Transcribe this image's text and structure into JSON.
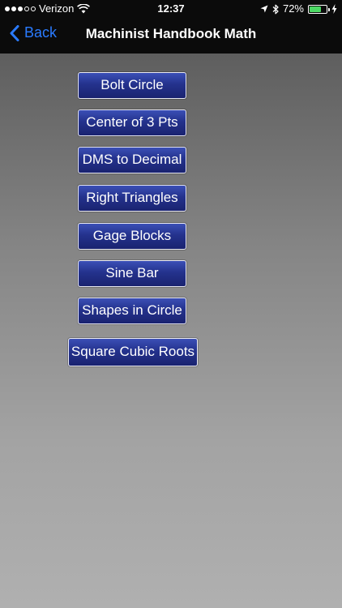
{
  "status_bar": {
    "carrier": "Verizon",
    "signal_bars_filled": 3,
    "signal_bars_total": 5,
    "wifi_icon": "wifi-icon",
    "time": "12:37",
    "location_icon": "location-arrow-icon",
    "bluetooth_icon": "bluetooth-icon",
    "battery_percent": "72%",
    "battery_level": 0.72,
    "battery_color": "#4cd964",
    "charging_icon": "charging-bolt-icon"
  },
  "nav": {
    "back_label": "Back",
    "title": "Machinist Handbook Math",
    "accent": "#2a7bff"
  },
  "menu": {
    "buttons": [
      "Bolt Circle",
      "Center of 3 Pts",
      "DMS to Decimal",
      "Right Triangles",
      "Gage Blocks",
      "Sine Bar",
      "Shapes in Circle",
      "Square Cubic Roots"
    ]
  }
}
